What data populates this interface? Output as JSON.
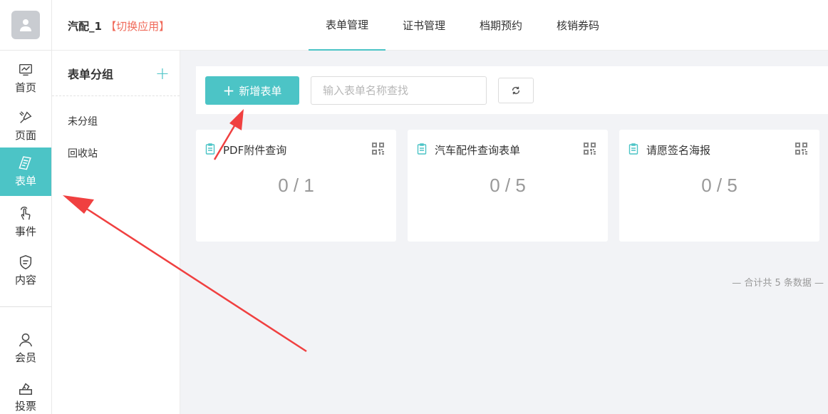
{
  "header": {
    "app_name": "汽配_1",
    "switch_label": "【切换应用】",
    "tabs": [
      {
        "label": "表单管理",
        "active": true
      },
      {
        "label": "证书管理",
        "active": false
      },
      {
        "label": "档期预约",
        "active": false
      },
      {
        "label": "核销券码",
        "active": false
      }
    ]
  },
  "sidebar": {
    "items": [
      {
        "label": "首页",
        "icon": "chart-icon"
      },
      {
        "label": "页面",
        "icon": "brush-icon"
      },
      {
        "label": "表单",
        "icon": "form-icon",
        "active": true
      },
      {
        "label": "事件",
        "icon": "hand-tap-icon"
      },
      {
        "label": "内容",
        "icon": "content-icon"
      },
      {
        "label": "会员",
        "icon": "user-icon"
      },
      {
        "label": "投票",
        "icon": "vote-icon"
      }
    ]
  },
  "groups": {
    "title": "表单分组",
    "items": [
      {
        "label": "未分组"
      },
      {
        "label": "回收站"
      }
    ]
  },
  "toolbar": {
    "add_label": "新增表单",
    "search_placeholder": "输入表单名称查找",
    "search_value": ""
  },
  "forms": [
    {
      "title": "PDF附件查询",
      "count": "0 / 1"
    },
    {
      "title": "汽车配件查询表单",
      "count": "0 / 5"
    },
    {
      "title": "请愿签名海报",
      "count": "0 / 5"
    }
  ],
  "footer": {
    "total_text": "— 合计共 5 条数据 —"
  },
  "colors": {
    "accent": "#4cc4c6",
    "switch": "#f06a5a",
    "annotation_arrow": "#f04040"
  }
}
